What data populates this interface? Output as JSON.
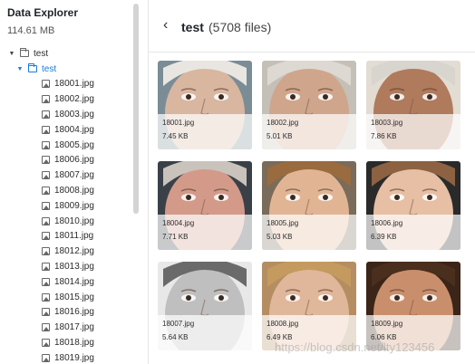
{
  "sidebar": {
    "title": "Data Explorer",
    "size": "114.61 MB",
    "tree": {
      "root": "test",
      "child": "test",
      "files": [
        "18001.jpg",
        "18002.jpg",
        "18003.jpg",
        "18004.jpg",
        "18005.jpg",
        "18006.jpg",
        "18007.jpg",
        "18008.jpg",
        "18009.jpg",
        "18010.jpg",
        "18011.jpg",
        "18012.jpg",
        "18013.jpg",
        "18014.jpg",
        "18015.jpg",
        "18016.jpg",
        "18017.jpg",
        "18018.jpg",
        "18019.jpg"
      ]
    }
  },
  "main": {
    "folder_title": "test",
    "file_count": "(5708 files)",
    "cards": [
      {
        "name": "18001.jpg",
        "size": "7.45 KB",
        "skin": "#d8b6a0",
        "hair": "#e9e6e1",
        "bg": "#7a8d96"
      },
      {
        "name": "18002.jpg",
        "size": "5.01 KB",
        "skin": "#cfa68c",
        "hair": "#ddd8d2",
        "bg": "#c4c0b8"
      },
      {
        "name": "18003.jpg",
        "size": "7.86 KB",
        "skin": "#b07a5c",
        "hair": "#d8d4ce",
        "bg": "#e2dcd2"
      },
      {
        "name": "18004.jpg",
        "size": "7.71 KB",
        "skin": "#d39a8a",
        "hair": "#c9c3bb",
        "bg": "#3a4048"
      },
      {
        "name": "18005.jpg",
        "size": "5.03 KB",
        "skin": "#e1b594",
        "hair": "#9a6b3f",
        "bg": "#7a6b5a"
      },
      {
        "name": "18006.jpg",
        "size": "6.39 KB",
        "skin": "#e6bfa4",
        "hair": "#8c6242",
        "bg": "#2a2a2a"
      },
      {
        "name": "18007.jpg",
        "size": "5.64 KB",
        "skin": "#bfbfbf",
        "hair": "#6a6a6a",
        "bg": "#e8e8e8"
      },
      {
        "name": "18008.jpg",
        "size": "6.49 KB",
        "skin": "#e0b79a",
        "hair": "#c49a5e",
        "bg": "#b48e62"
      },
      {
        "name": "18009.jpg",
        "size": "6.06 KB",
        "skin": "#c98f6c",
        "hair": "#4a2e1e",
        "bg": "#3b2418"
      }
    ]
  },
  "watermark": "https://blog.csdn.net/lty123456"
}
